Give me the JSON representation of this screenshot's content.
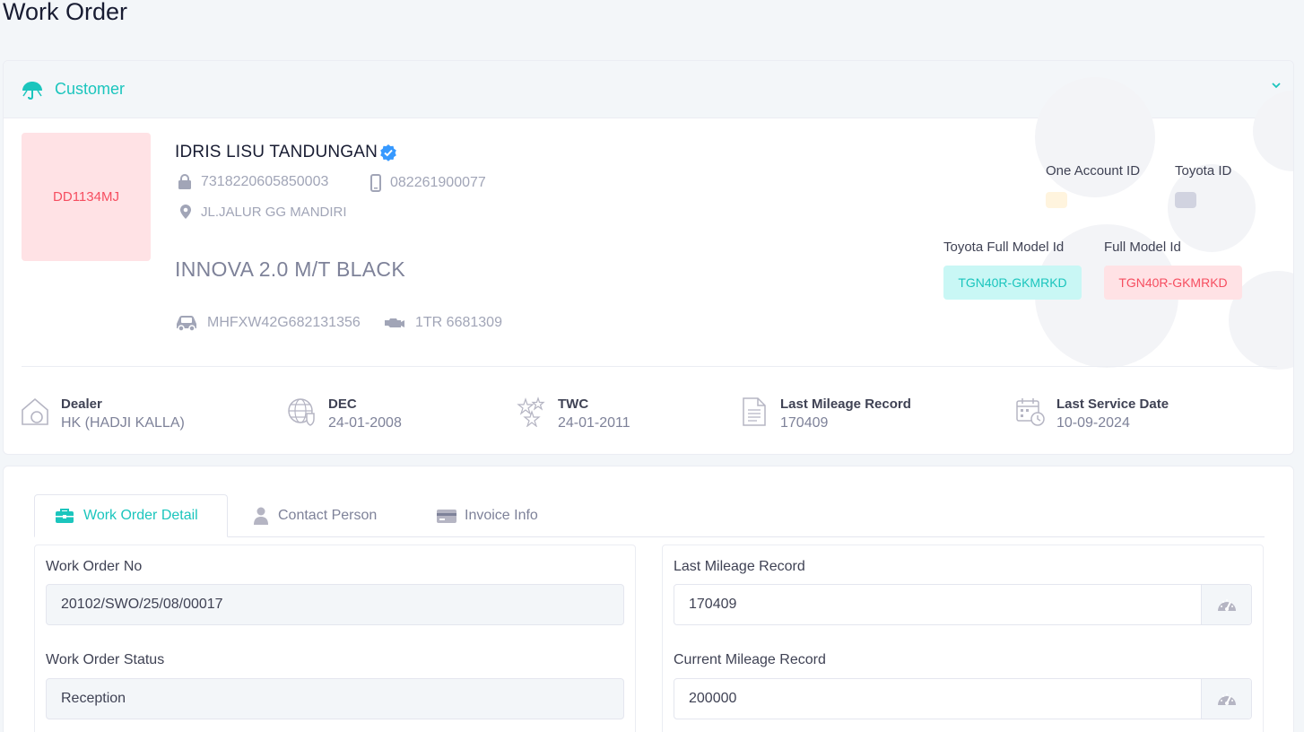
{
  "page": {
    "title": "Work Order"
  },
  "customer_section": {
    "title": "Customer",
    "icon": "umbrella-icon",
    "collapse_icon": "chevron-down-icon",
    "plate": "DD1134MJ",
    "name": "IDRIS LISU TANDUNGAN",
    "verified_icon": "verified-badge-icon",
    "id_number": "7318220605850003",
    "phone": "082261900077",
    "address": "JL.JALUR GG MANDIRI",
    "vehicle_model": "INNOVA 2.0 M/T BLACK",
    "vin": "MHFXW42G682131356",
    "engine_no": "1TR 6681309",
    "one_account_id_label": "One Account ID",
    "toyota_id_label": "Toyota ID",
    "toyota_full_model_label": "Toyota Full Model Id",
    "toyota_full_model_value": "TGN40R-GKMRKD",
    "full_model_label": "Full Model Id",
    "full_model_value": "TGN40R-GKMRKD",
    "colors": {
      "accent": "#1bc5bd",
      "danger": "#f64e60",
      "danger_light": "#ffe2e5",
      "accent_light": "#c9f7f5",
      "warning_light": "#fff4de"
    }
  },
  "stats": [
    {
      "label": "Dealer",
      "value": "HK (HADJI KALLA)",
      "icon": "house-icon"
    },
    {
      "label": "DEC",
      "value": "24-01-2008",
      "icon": "globe-shield-icon"
    },
    {
      "label": "TWC",
      "value": "24-01-2011",
      "icon": "stars-icon"
    },
    {
      "label": "Last Mileage Record",
      "value": "170409",
      "icon": "document-icon"
    },
    {
      "label": "Last Service Date",
      "value": "10-09-2024",
      "icon": "calendar-clock-icon"
    }
  ],
  "tabs": [
    {
      "label": "Work Order Detail",
      "icon": "briefcase-icon",
      "active": true
    },
    {
      "label": "Contact Person",
      "icon": "user-icon",
      "active": false
    },
    {
      "label": "Invoice Info",
      "icon": "credit-card-icon",
      "active": false
    }
  ],
  "form": {
    "work_order_no_label": "Work Order No",
    "work_order_no": "20102/SWO/25/08/00017",
    "work_order_status_label": "Work Order Status",
    "work_order_status": "Reception",
    "last_mileage_label": "Last Mileage Record",
    "last_mileage": "170409",
    "current_mileage_label": "Current Mileage Record",
    "current_mileage": "200000",
    "gauge_icon": "speedometer-icon"
  }
}
